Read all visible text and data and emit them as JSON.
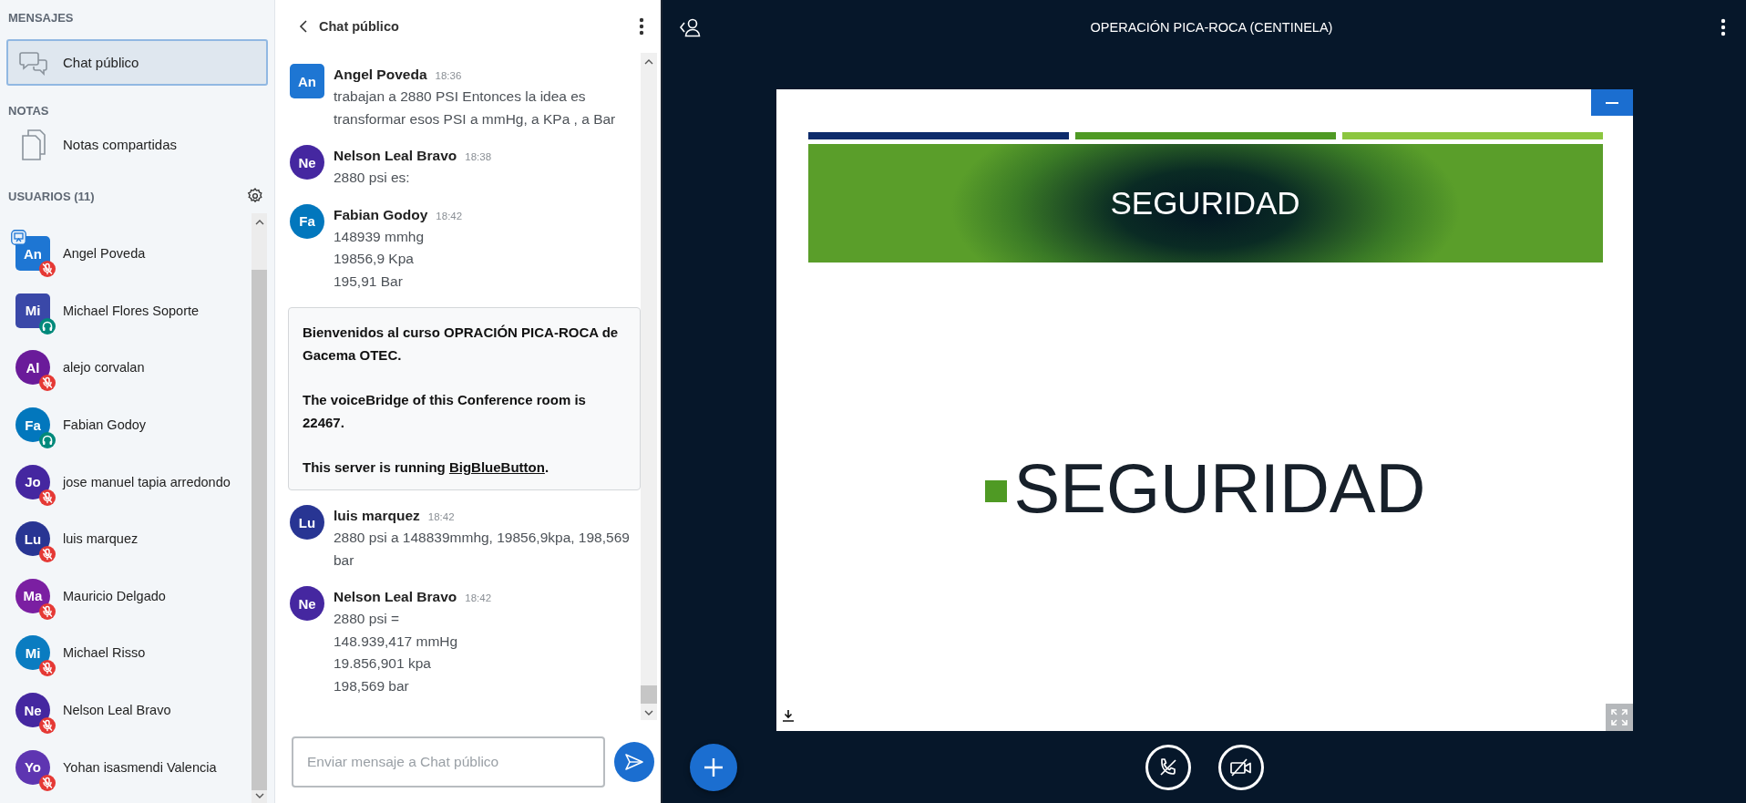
{
  "sidebar": {
    "messages_heading": "MENSAJES",
    "chats": [
      {
        "label": "Chat público",
        "selected": true
      }
    ],
    "notes_heading": "NOTAS",
    "notes": [
      {
        "label": "Notas compartidas"
      }
    ],
    "users_heading": "USUARIOS (11)",
    "users": [
      {
        "initials": "An",
        "name": "Angel Poveda",
        "color": "#1e76d3",
        "moderator": true,
        "presenter": true,
        "listen_only": false
      },
      {
        "initials": "Mi",
        "name": "Michael Flores Soporte",
        "color": "#3a48a8",
        "moderator": true,
        "presenter": false,
        "listen_only": true
      },
      {
        "initials": "Al",
        "name": "alejo corvalan",
        "color": "#6a1b9a",
        "moderator": false,
        "presenter": false,
        "listen_only": false
      },
      {
        "initials": "Fa",
        "name": "Fabian Godoy",
        "color": "#0277bd",
        "moderator": false,
        "presenter": false,
        "listen_only": true
      },
      {
        "initials": "Jo",
        "name": "jose manuel tapia arredondo",
        "color": "#4527a0",
        "moderator": false,
        "presenter": false,
        "listen_only": false
      },
      {
        "initials": "Lu",
        "name": "luis marquez",
        "color": "#283593",
        "moderator": false,
        "presenter": false,
        "listen_only": false
      },
      {
        "initials": "Ma",
        "name": "Mauricio Delgado",
        "color": "#7b1fa2",
        "moderator": false,
        "presenter": false,
        "listen_only": false
      },
      {
        "initials": "Mi",
        "name": "Michael Risso",
        "color": "#0a7cc1",
        "moderator": false,
        "presenter": false,
        "listen_only": false
      },
      {
        "initials": "Ne",
        "name": "Nelson Leal Bravo",
        "color": "#4527a0",
        "moderator": false,
        "presenter": false,
        "listen_only": false
      },
      {
        "initials": "Yo",
        "name": "Yohan isasmendi Valencia",
        "color": "#5e35b1",
        "moderator": false,
        "presenter": false,
        "listen_only": false
      }
    ]
  },
  "chat": {
    "title": "Chat público",
    "messages": [
      {
        "kind": "message",
        "initials": "An",
        "author": "Angel Poveda",
        "time": "18:36",
        "color": "#1e76d3",
        "moderator": true,
        "lines": [
          "trabajan a 2880 PSI Entonces la idea es transformar esos PSI a mmHg, a KPa , a Bar"
        ]
      },
      {
        "kind": "message",
        "initials": "Ne",
        "author": "Nelson Leal Bravo",
        "time": "18:38",
        "color": "#4527a0",
        "moderator": false,
        "lines": [
          "2880 psi es:"
        ]
      },
      {
        "kind": "message",
        "initials": "Fa",
        "author": "Fabian Godoy",
        "time": "18:42",
        "color": "#0277bd",
        "moderator": false,
        "lines": [
          "148939 mmhg",
          "19856,9 Kpa",
          "195,91 Bar"
        ]
      },
      {
        "kind": "welcome",
        "paragraphs": [
          "Bienvenidos al curso OPRACIÓN PICA-ROCA de Gacema OTEC.",
          "The voiceBridge of this Conference room is 22467."
        ],
        "link_prefix": "This server is running ",
        "link": "BigBlueButton",
        "link_suffix": "."
      },
      {
        "kind": "message",
        "initials": "Lu",
        "author": "luis marquez",
        "time": "18:42",
        "color": "#283593",
        "moderator": false,
        "lines": [
          "2880 psi a 148839mmhg, 19856,9kpa, 198,569 bar"
        ]
      },
      {
        "kind": "message",
        "initials": "Ne",
        "author": "Nelson Leal Bravo",
        "time": "18:42",
        "color": "#4527a0",
        "moderator": false,
        "lines": [
          "2880 psi =",
          "148.939,417 mmHg",
          "19.856,901 kpa",
          "198,569 bar"
        ]
      }
    ],
    "input": {
      "placeholder": "Enviar mensaje a Chat público"
    }
  },
  "presentation": {
    "title": "OPERACIÓN PICA-ROCA (CENTINELA)",
    "slide": {
      "banner_title": "SEGURIDAD",
      "bullets": [
        "SEGURIDAD"
      ]
    }
  }
}
